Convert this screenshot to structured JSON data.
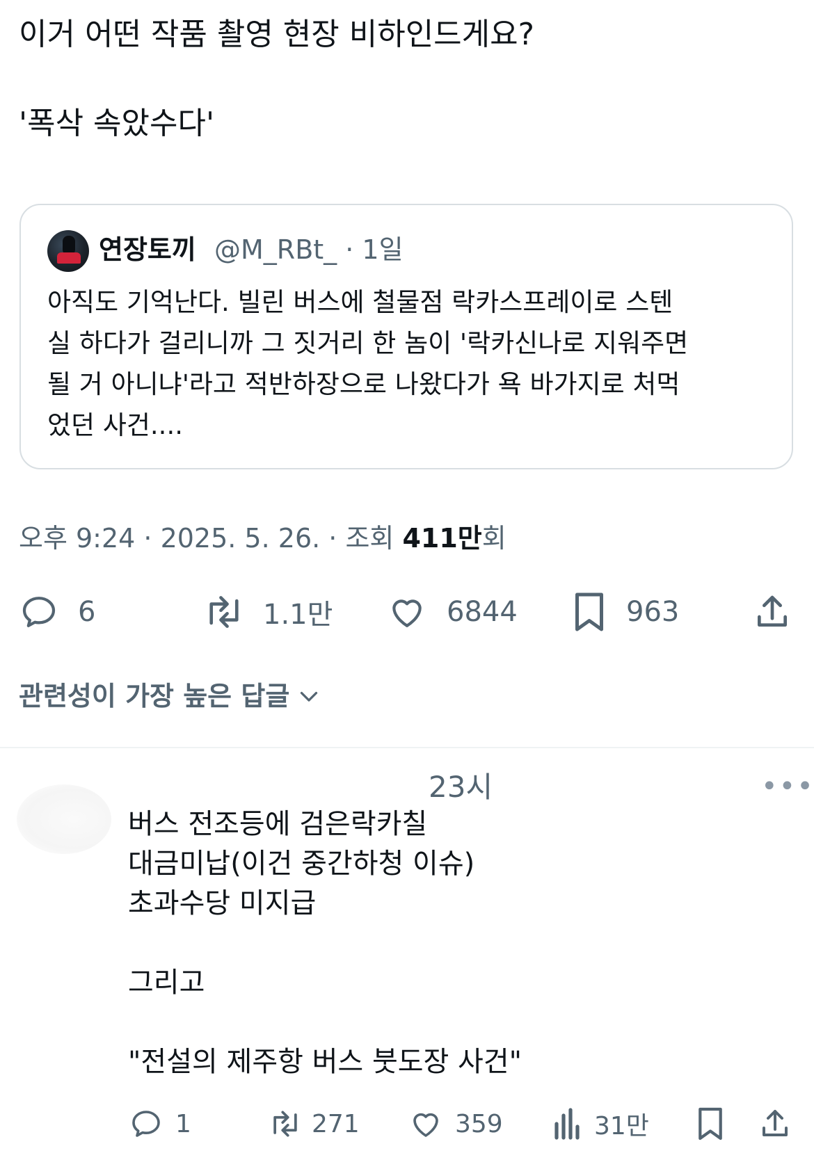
{
  "tweet": {
    "text_line1": "이거 어떤 작품 촬영 현장 비하인드게요?",
    "text_line2": "'폭삭 속았수다'"
  },
  "quote": {
    "name": "연장토끼",
    "handle": "@M_RBt_ · 1일",
    "body": "아직도 기억난다. 빌린 버스에 철물점 락카스프레이로 스텐\n실 하다가 걸리니까 그 짓거리 한 놈이 '락카신나로 지워주면\n될 거 아니냐'라고 적반하장으로 나왔다가 욕 바가지로 처먹\n었던 사건...."
  },
  "meta": {
    "time": "오후 9:24 · 2025. 5. 26. · 조회 ",
    "views": "411만",
    "views_suffix": "회"
  },
  "actions": {
    "replies": "6",
    "retweets": "1.1만",
    "likes": "6844",
    "bookmarks": "963"
  },
  "sort_label": "관련성이 가장 높은 답글",
  "reply": {
    "time": "23시",
    "more": "•••",
    "body": "버스 전조등에 검은락카칠\n대금미납(이건 중간하청 이슈)\n초과수당 미지급\n\n그리고\n\n\"전설의 제주항 버스 붓도장 사건\"",
    "replies": "1",
    "retweets": "271",
    "likes": "359",
    "views": "31만"
  },
  "colors": {
    "text": "#0f1419",
    "secondary": "#536471",
    "border": "#d8dee2"
  }
}
